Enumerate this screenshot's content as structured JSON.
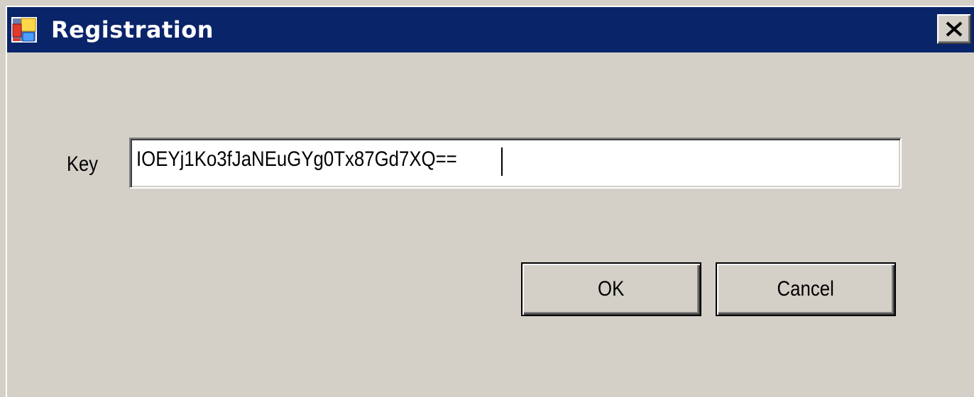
{
  "window": {
    "title": "Registration",
    "title_bar_color": "#0a246a",
    "background_color": "#d4d0c8",
    "icons": {
      "app": "registration-app-icon",
      "close": "close-icon"
    }
  },
  "form": {
    "key_label": "Key",
    "key_value": "IOEYj1Ko3fJaNEuGYg0Tx87Gd7XQ=="
  },
  "buttons": {
    "ok_label": "OK",
    "cancel_label": "Cancel"
  }
}
